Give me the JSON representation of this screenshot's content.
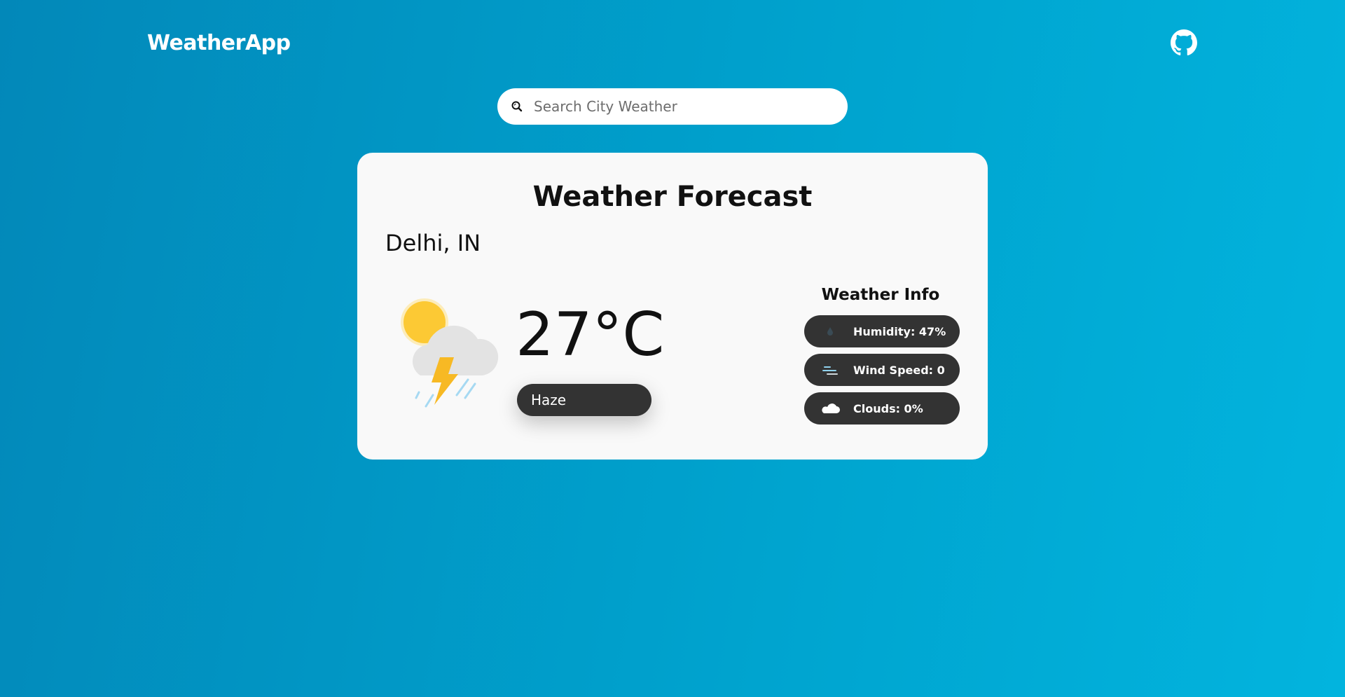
{
  "header": {
    "brand": "WeatherApp",
    "github_icon": "github-icon"
  },
  "search": {
    "placeholder": "Search City Weather",
    "value": "",
    "icon": "search-icon"
  },
  "card": {
    "title": "Weather Forecast",
    "city": "Delhi, IN",
    "temperature": "27°C",
    "condition": "Haze",
    "weather_icon": "thunderstorm-sun-icon",
    "info": {
      "title": "Weather Info",
      "items": [
        {
          "label": "Humidity: 47%",
          "icon": "droplet-icon"
        },
        {
          "label": "Wind Speed: 0",
          "icon": "wind-icon"
        },
        {
          "label": "Clouds: 0%",
          "icon": "cloud-icon"
        }
      ]
    }
  },
  "colors": {
    "background_start": "#0288b9",
    "background_end": "#02b4de",
    "card": "#f9f9f9",
    "pill": "#333333",
    "sun": "#fcc934"
  }
}
